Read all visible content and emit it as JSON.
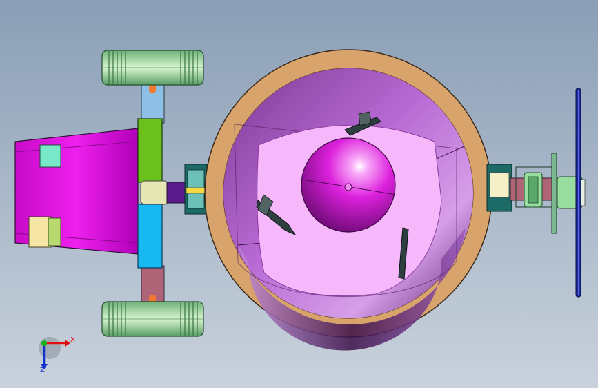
{
  "viewport": {
    "background_top": "#8a9eb6",
    "background_bottom": "#c9d2dc"
  },
  "colors": {
    "wheel_tread": "#bde8b4",
    "wheel_groove": "#3f7a48",
    "rim_tan": "#d9a36c",
    "drum_dark": "#6e2f86",
    "drum_mid": "#b267d0",
    "drum_light": "#d9a0ec",
    "inner_pink": "#f6b8fb",
    "ball": "#d81ed8",
    "motor_magenta": "#e012e0",
    "bracket_green": "#6cc01c",
    "bracket_cyan": "#18b8f0",
    "axle_blue": "#8ec0e6",
    "axle_maroon": "#b06478",
    "shaft_purple": "#5a1c8c",
    "handwheel_blue": "#1f2a9e",
    "coupling_cream": "#f5f0c8",
    "coupling_green": "#98dca0"
  },
  "triad": {
    "x_label": "X",
    "z_label": "Z",
    "x_color": "#e01010",
    "y_color": "#18b018",
    "z_color": "#1030d0"
  }
}
